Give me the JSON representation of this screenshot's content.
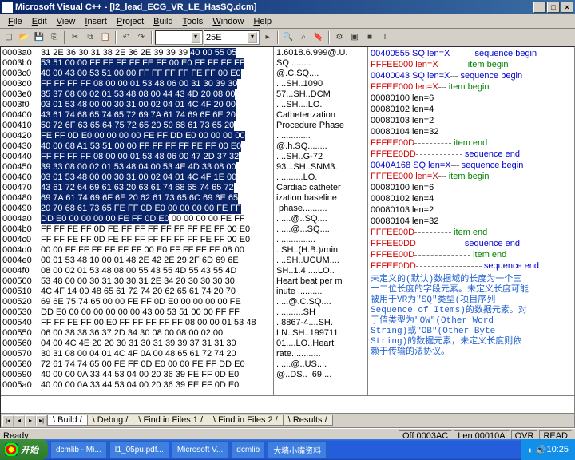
{
  "title": "Microsoft Visual C++ - [I2_lead_ECG_VR_LE_HasSQ.dcm]",
  "menus": [
    "File",
    "Edit",
    "View",
    "Insert",
    "Project",
    "Build",
    "Tools",
    "Window",
    "Help"
  ],
  "combo1": "25E",
  "hex": {
    "rows": [
      {
        "a": "0003a0",
        "b": "31 2E 36 30 31 38 2E 36 2E 39 39 39 ",
        "s": "40 00 55 05"
      },
      {
        "a": "0003b0",
        "s": "53 51 00 00 FF FF FF FF FE FF 00 E0 FF FF FF FF"
      },
      {
        "a": "0003c0",
        "s": "40 00 43 00 53 51 00 00 FF FF FF FF FE FF 00 E0"
      },
      {
        "a": "0003d0",
        "s": "FF FF FF FF 08 00 00 01 53 48 06 00 31 30 39 30"
      },
      {
        "a": "0003e0",
        "s": "35 37 08 00 02 01 53 48 08 00 44 43 4D 20 08 00"
      },
      {
        "a": "0003f0",
        "s": "03 01 53 48 00 00 30 31 00 02 04 01 4C 4F 20 00"
      },
      {
        "a": "000400",
        "s": "43 61 74 68 65 74 65 72 69 7A 61 74 69 6F 6E 20"
      },
      {
        "a": "000410",
        "s": "50 72 6F 63 65 64 75 72 65 20 50 68 61 73 65 20"
      },
      {
        "a": "000420",
        "s": "FE FF 0D E0 00 00 00 00 FE FF DD E0 00 00 00 00"
      },
      {
        "a": "000430",
        "s": "40 00 68 A1 53 51 00 00 FF FF FF FF FE FF 00 E0"
      },
      {
        "a": "000440",
        "s": "FF FF FF FF 08 00 00 01 53 48 06 00 47 2D 37 32"
      },
      {
        "a": "000450",
        "s": "39 33 08 00 02 01 53 48 04 00 53 4E 4D 33 08 00"
      },
      {
        "a": "000460",
        "s": "03 01 53 48 00 00 30 31 00 02 04 01 4C 4F 1E 00"
      },
      {
        "a": "000470",
        "s": "43 61 72 64 69 61 63 20 63 61 74 68 65 74 65 72"
      },
      {
        "a": "000480",
        "s": "69 7A 61 74 69 6F 6E 20 62 61 73 65 6C 69 6E 65"
      },
      {
        "a": "000490",
        "s": "20 70 68 61 73 65 FE FF 0D E0 00 00 00 00 FE FF"
      },
      {
        "a": "0004a0",
        "s": "DD E0 00 00 00 00 FE FF 0D E0",
        "b2": " 00 00 00 00 FE FF"
      },
      {
        "a": "0004b0",
        "b": "FF FF FE FF 0D FE FF FF FF FF FF FF FE FF 00 E0"
      },
      {
        "a": "0004c0",
        "b": "FF FF FE FF 0D FE FF FF FF FF FF FF FE FF 00 E0"
      },
      {
        "a": "0004d0",
        "b": "00 00 FF FF FF FF FF FF 00 E0 FF FF FF FF 08 00"
      },
      {
        "a": "0004e0",
        "b": "00 01 53 48 10 00 01 48 2E 42 2E 29 2F 6D 69 6E"
      },
      {
        "a": "0004f0",
        "b": "08 00 02 01 53 48 08 00 55 43 55 4D 55 43 55 4D"
      },
      {
        "a": "000500",
        "b": "53 48 00 00 30 31 30 30 31 2E 34 20 30 30 30 30"
      },
      {
        "a": "000510",
        "b": "4C 4F 14 00 48 65 61 72 74 20 62 65 61 74 20 70"
      },
      {
        "a": "000520",
        "b": "69 6E 75 74 65 00 00 FE FF 0D E0 00 00 00 00 FE"
      },
      {
        "a": "000530",
        "b": "DD E0 00 00 00 00 00 00 43 00 53 51 00 00 FF FF"
      },
      {
        "a": "000540",
        "b": "FF FF FE FF 00 E0 FF FF FF FF FF 08 00 00 01 53 48"
      },
      {
        "a": "000550",
        "b": "06 00 38 38 36 37 2D 34 30 08 00 08 00 02 00"
      },
      {
        "a": "000560",
        "b": "04 00 4C 4E 20 20 30 31 30 31 39 39 37 31 31 30"
      },
      {
        "a": "000570",
        "b": "30 31 08 00 04 01 4C 4F 0A 00 48 65 61 72 74 20"
      },
      {
        "a": "000580",
        "b": "72 61 74 74 65 00 FE FF 0D E0 00 00 FE FF DD E0"
      },
      {
        "a": "000590",
        "b": "40 00 00 0A 33 44 53 04 00 20 36 39 FE FF 0D E0"
      },
      {
        "a": "0005a0",
        "b": "40 00 00 0A 33 44 53 04 00 20 36 39 FE FF 0D E0"
      }
    ]
  },
  "ascii": [
    "1.6018.6.999@.U.",
    "SQ ........",
    "@.C.SQ....",
    "....SH..1090",
    "57...SH..DCM",
    "....SH....LO.",
    "Catheterization",
    "Procedure Phase",
    "..............",
    "@.h.SQ........",
    "....SH..G-72",
    "93...SH..SNM3.",
    "...........LO.",
    "Cardiac catheter",
    "ization baseline",
    " phase..........",
    "......@..SQ....",
    "......@...SQ....",
    "................",
    "..SH..(H.B.)/min",
    "....SH..UCUM....",
    "SH..1.4 ....LO..",
    "Heart beat per m",
    "inute ..........",
    ".....@.C.SQ....",
    "...........SH",
    "..8867-4....SH.",
    "LN..SH..199711",
    "01....LO..Heart",
    "rate............",
    "......@..US....",
    "@..DS..  69...."
  ],
  "tree": [
    {
      "t": "00400555 SQ len=X",
      "c": "seq",
      "r": "sequence begin",
      "rc": "seq"
    },
    {
      "t": "  FFFEE000 len=X",
      "c": "seqr",
      "r": "item begin",
      "rc": "seqg"
    },
    {
      "t": "    00400043 SQ len=X",
      "c": "seq",
      "r": "sequence begin",
      "rc": "seq"
    },
    {
      "t": "      FFFEE000 len=X",
      "c": "seqr",
      "r": "item begin",
      "rc": "seqg"
    },
    {
      "t": "        00080100 len=6",
      "c": ""
    },
    {
      "t": "        00080102 len=4",
      "c": ""
    },
    {
      "t": "        00080103 len=2",
      "c": ""
    },
    {
      "t": "        00080104 len=32",
      "c": ""
    },
    {
      "t": "",
      "c": ""
    },
    {
      "t": "      FFFEE00D",
      "c": "seqr",
      "r": "item end",
      "rc": "seqg"
    },
    {
      "t": "    FFFEE0DD",
      "c": "seqr",
      "r": "sequence end",
      "rc": "seq"
    },
    {
      "t": "    0040A168 SQ len=X",
      "c": "seq",
      "r": "sequence begin",
      "rc": "seq"
    },
    {
      "t": "      FFFEE000 len=X",
      "c": "seqr",
      "r": "item begin",
      "rc": "seqg"
    },
    {
      "t": "        00080100 len=6",
      "c": ""
    },
    {
      "t": "        00080102 len=4",
      "c": ""
    },
    {
      "t": "        00080103 len=2",
      "c": ""
    },
    {
      "t": "        00080104 len=32",
      "c": ""
    },
    {
      "t": "",
      "c": ""
    },
    {
      "t": "      FFFEE00D",
      "c": "seqr",
      "r": "item end",
      "rc": "seqg"
    },
    {
      "t": "    FFFEE0DD",
      "c": "seqr",
      "r": "sequence end",
      "rc": "seq"
    },
    {
      "t": "  FFFEE00D",
      "c": "seqr",
      "r": "item end",
      "rc": "seqg"
    },
    {
      "t": "FFFEE0DD",
      "c": "seqr",
      "r": "sequence end",
      "rc": "seq"
    }
  ],
  "note": "未定义的(默认)数据域的长度为一个三十二位长度的字段元素。未定义长度可能被用于VR为\"SQ\"类型(项目序列 Sequence of Items)的数据元素。对于值类型为\"OW\"(Other Word String)或\"OB\"(Other Byte String)的数据元素，未定义长度则依赖于传输的法协议。",
  "tabs": [
    "Build",
    "Debug",
    "Find in Files 1",
    "Find in Files 2",
    "Results"
  ],
  "status": {
    "ready": "Ready",
    "off": "Off 0003AC",
    "len": "Len 00010A",
    "ovr": "OVR",
    "read": "READ"
  },
  "taskbar": {
    "start": "开始",
    "items": [
      "dcmlib - Mi...",
      "I1_05pu.pdf...",
      "Microsoft V...",
      "dcmlib",
      "大墙小嘴资料"
    ],
    "time": "10:25"
  }
}
